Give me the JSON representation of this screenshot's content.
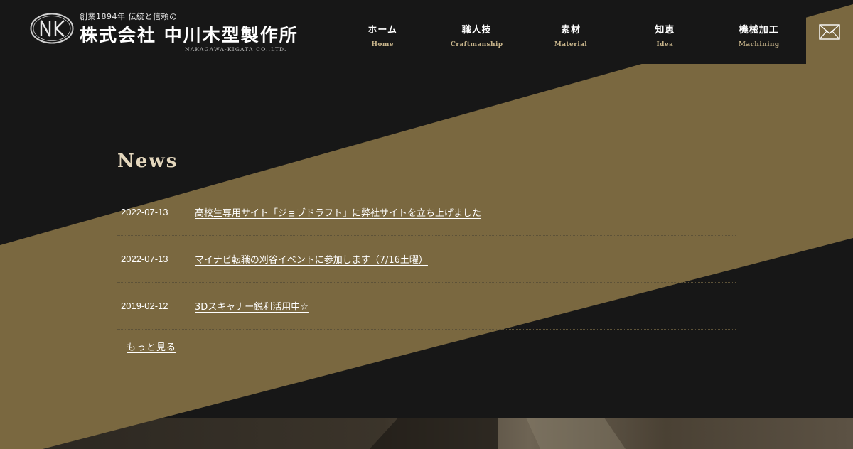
{
  "header": {
    "logo": {
      "mark_letters": "NK",
      "tagline": "創業1894年 伝統と信頼の",
      "company_name": "株式会社 中川木型製作所",
      "company_name_roman": "NAKAGAWA-KIGATA CO.,LTD."
    },
    "nav": [
      {
        "jp": "ホーム",
        "en": "Home"
      },
      {
        "jp": "職人技",
        "en": "Craftmanship"
      },
      {
        "jp": "素材",
        "en": "Material"
      },
      {
        "jp": "知恵",
        "en": "Idea"
      },
      {
        "jp": "機械加工",
        "en": "Machining"
      }
    ],
    "contact_icon": "mail-icon"
  },
  "news": {
    "title": "News",
    "items": [
      {
        "date": "2022-07-13",
        "title": "高校生専用サイト「ジョブドラフト」に弊社サイトを立ち上げました"
      },
      {
        "date": "2022-07-13",
        "title": "マイナビ転職の刈谷イベントに参加します（7/16土曜）"
      },
      {
        "date": "2019-02-12",
        "title": "3Dスキャナー鋭利活用中☆"
      }
    ],
    "more_label": "もっと見る"
  },
  "colors": {
    "background": "#171717",
    "accent_band": "#7a6840",
    "nav_en": "#c6b38a",
    "news_title": "#e4d7bd"
  }
}
